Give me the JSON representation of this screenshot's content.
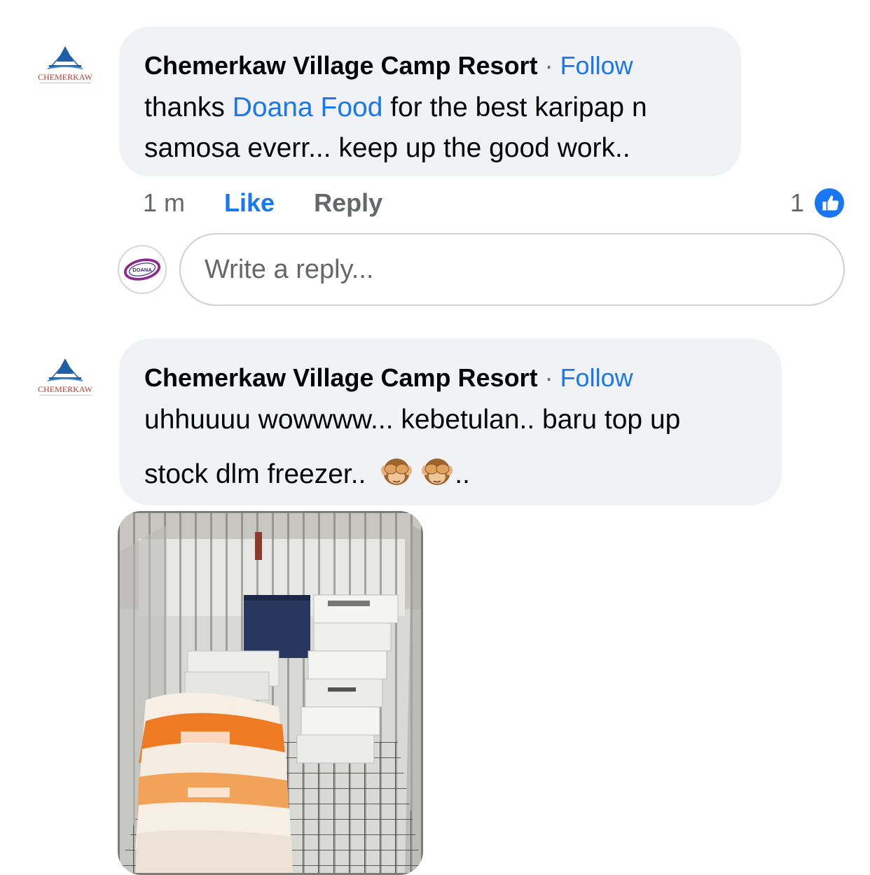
{
  "comments": [
    {
      "author": "Chemerkaw Village Camp Resort",
      "separator": "·",
      "follow_label": "Follow",
      "text_line1_before": "thanks ",
      "text_line1_mention": "Doana Food",
      "text_line1_after": " for the best karipap n",
      "text_line2": "samosa everr... keep up the good work..",
      "logo_text": "CHEMERKAW"
    },
    {
      "author": "Chemerkaw Village Camp Resort",
      "separator": "·",
      "follow_label": "Follow",
      "text_line1": "uhhuuuu wowwww... kebetulan.. baru top up",
      "text_line2": "stock dlm freezer..",
      "text_line2_suffix": "..",
      "emoji": [
        "see-no-evil-monkey",
        "see-no-evil-monkey"
      ],
      "logo_text": "CHEMERKAW"
    }
  ],
  "actions": {
    "time": "1 m",
    "like_label": "Like",
    "reply_label": "Reply",
    "reaction_count": "1",
    "reaction_icon": "thumbs-up-icon"
  },
  "reply_box": {
    "placeholder": "Write a reply...",
    "avatar_text": "DOANA"
  },
  "colors": {
    "accent": "#1877f2",
    "bubble": "#f0f2f5",
    "secondary_text": "#65676b",
    "logo_red": "#c0392b",
    "logo_blue": "#1f5fa8"
  }
}
